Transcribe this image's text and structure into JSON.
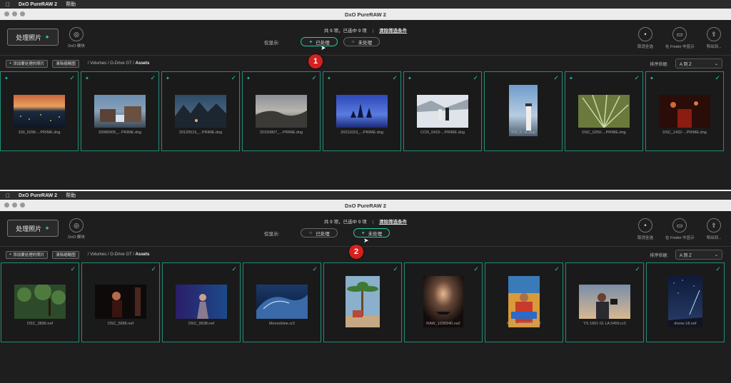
{
  "menu": {
    "apple": "",
    "app": "DxO PureRAW 2",
    "help": "帮助"
  },
  "window_title": "DxO PureRAW 2",
  "toolbar": {
    "process_label": "处理照片",
    "dxo_module_label": "DxO 模块",
    "summary": "共 9 项，已选中 9 项",
    "clear_filter": "清除筛选条件",
    "show_only_label": "仅显示:",
    "processed_label": "已处理",
    "unprocessed_label": "未处理",
    "deselect_all": "取消全选",
    "show_in_finder": "在 Finder 中显示",
    "export": "导出到..."
  },
  "subbar": {
    "add_photos": "添加要处理的照片",
    "clear_thumbnails": "清除缩略图",
    "breadcrumb_path": "/ Volumes / G-Drive GT / ",
    "breadcrumb_current": "Assets",
    "sort_label": "排序依据:",
    "sort_value": "A 到 Z"
  },
  "panel1_files": [
    {
      "name": "100_0296-...PRIME.dng"
    },
    {
      "name": "20080905_...PRIME.dng"
    },
    {
      "name": "20120519_...PRIME.dng"
    },
    {
      "name": "20150807_...PRIME.dng"
    },
    {
      "name": "20211019_...PRIME.dng"
    },
    {
      "name": "CCR_0415-...PRIME.dng"
    },
    {
      "name": "DJI_0...E.dng"
    },
    {
      "name": "DSC_0250-...PRIME.dng"
    },
    {
      "name": "DSC_1432-...PRIME.dng"
    }
  ],
  "panel2_files": [
    {
      "name": "DSC_3896.nef"
    },
    {
      "name": "DSC_5686.nef"
    },
    {
      "name": "DSC_9638.nef"
    },
    {
      "name": "Moonshine.cr2"
    },
    {
      "name": "RAWHai...90.nef"
    },
    {
      "name": "RAW_1036940.rw2"
    },
    {
      "name": "RAW_1044346.rw2"
    },
    {
      "name": "YS 1601 01 LA 0459.cr2"
    },
    {
      "name": "drone-18.nef"
    }
  ],
  "badges": {
    "one": "1",
    "two": "2"
  }
}
